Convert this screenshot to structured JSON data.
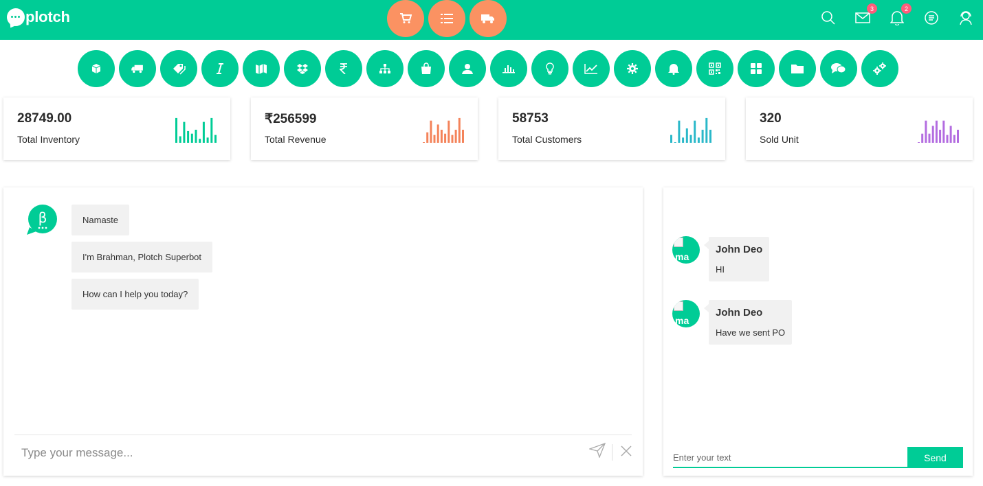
{
  "app": {
    "logo_text": "plotch"
  },
  "topbar": {
    "quick_actions": [
      "cart-icon",
      "list-icon",
      "truck-icon"
    ],
    "icons": [
      {
        "name": "search-icon"
      },
      {
        "name": "mail-icon",
        "badge": "3"
      },
      {
        "name": "bell-icon",
        "badge": "2"
      },
      {
        "name": "chat-icon"
      },
      {
        "name": "support-icon"
      }
    ]
  },
  "modules": [
    "box-icon",
    "truck-icon",
    "tag-icon",
    "italic-icon",
    "map-icon",
    "dropbox-icon",
    "rupee-icon",
    "sitemap-icon",
    "shopping-bag-icon",
    "user-icon",
    "bar-chart-icon",
    "bulb-icon",
    "line-chart-icon",
    "gear-icon",
    "bell-icon",
    "qr-code-icon",
    "grid-icon",
    "folder-icon",
    "comments-icon",
    "cogs-icon"
  ],
  "stats": [
    {
      "value": "28749.00",
      "label": "Total Inventory",
      "color": "#00cc96",
      "bars": [
        0.95,
        0.25,
        0.8,
        0.45,
        0.35,
        0.5,
        0.15,
        0.8,
        0.2,
        0.95,
        0.3
      ]
    },
    {
      "value": "₹256599",
      "label": "Total Revenue",
      "color": "#f4835a",
      "bars": [
        0.02,
        0.4,
        0.85,
        0.3,
        0.7,
        0.5,
        0.35,
        0.85,
        0.3,
        0.5,
        0.95,
        0.5
      ]
    },
    {
      "value": "58753",
      "label": "Total Customers",
      "color": "#2ab8c9",
      "bars": [
        0.3,
        0.02,
        0.85,
        0.2,
        0.55,
        0.3,
        0.85,
        0.2,
        0.5,
        0.95,
        0.5
      ]
    },
    {
      "value": "320",
      "label": "Sold Unit",
      "color": "#b36ce0",
      "bars": [
        0.02,
        0.35,
        0.85,
        0.35,
        0.65,
        0.85,
        0.5,
        0.85,
        0.3,
        0.65,
        0.3,
        0.5
      ]
    }
  ],
  "bot_chat": {
    "messages": [
      "Namaste",
      "I'm Brahman, Plotch Superbot",
      "How can I help you today?"
    ],
    "input_placeholder": "Type your message..."
  },
  "user_chat": {
    "messages": [
      {
        "name": "John Deo",
        "text": "HI"
      },
      {
        "name": "John Deo",
        "text": "Have we sent PO"
      }
    ],
    "input_placeholder": "Enter your text",
    "send_label": "Send"
  },
  "colors": {
    "brand": "#00cc96",
    "accent": "#fb9262"
  }
}
